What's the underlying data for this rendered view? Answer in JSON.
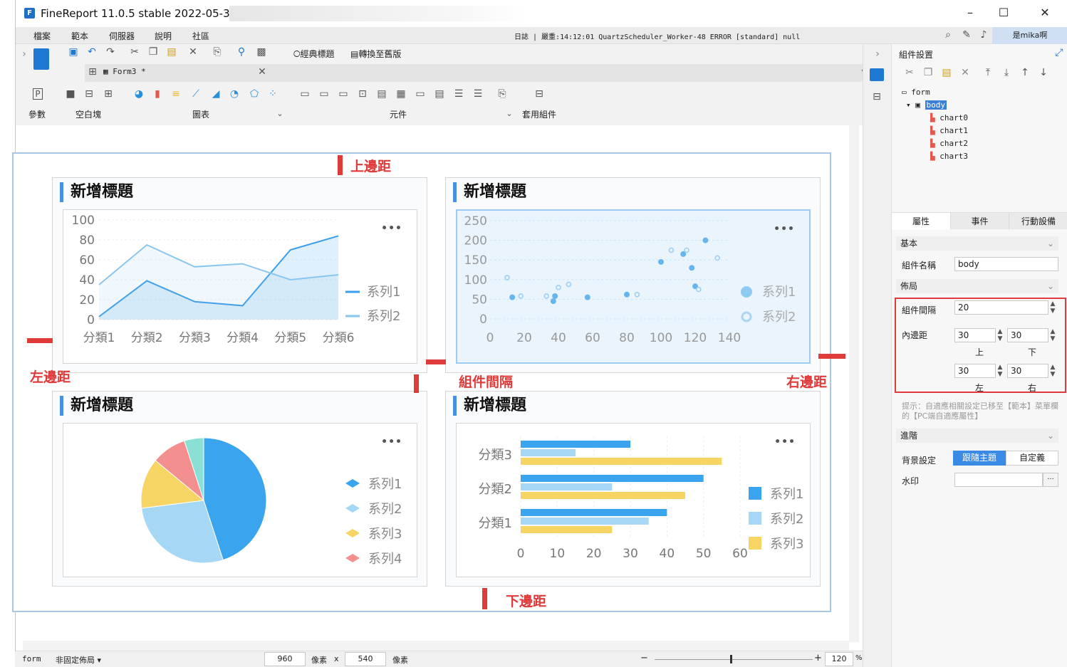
{
  "window": {
    "title": "FineReport 11.0.5 stable 2022-05-30"
  },
  "menu": {
    "items": [
      "檔案",
      "範本",
      "伺服器",
      "說明",
      "社區"
    ],
    "log": "日誌 | 嚴重:14:12:01 QuartzScheduler_Worker-48 ERROR [standard] null",
    "user": "是mika啊"
  },
  "toolbar": {
    "classic_title": "經典標題",
    "switch_old": "轉換至舊版",
    "tab_name": "Form3 *",
    "groups": [
      "參數",
      "空白塊",
      "圖表",
      "元件",
      "套用組件"
    ]
  },
  "annotations": {
    "top": "上邊距",
    "left": "左邊距",
    "gap": "組件間隔",
    "right": "右邊距",
    "bottom": "下邊距"
  },
  "cards": [
    {
      "title": "新增標題"
    },
    {
      "title": "新增標題"
    },
    {
      "title": "新增標題"
    },
    {
      "title": "新增標題"
    }
  ],
  "chart_data": [
    {
      "type": "area",
      "categories": [
        "分類1",
        "分類2",
        "分類3",
        "分類4",
        "分類5",
        "分類6"
      ],
      "series": [
        {
          "name": "系列1",
          "values": [
            3,
            39,
            18,
            14,
            70,
            84
          ]
        },
        {
          "name": "系列2",
          "values": [
            35,
            75,
            53,
            56,
            40,
            45
          ]
        }
      ],
      "ylim": [
        0,
        100
      ],
      "yticks": [
        0,
        20,
        40,
        60,
        80,
        100
      ],
      "legend": "right"
    },
    {
      "type": "scatter",
      "series": [
        {
          "name": "系列1",
          "points": [
            [
              13,
              55
            ],
            [
              38,
              58
            ],
            [
              37,
              45
            ],
            [
              57,
              55
            ],
            [
              80,
              62
            ],
            [
              100,
              145
            ],
            [
              118,
              130
            ],
            [
              113,
              165
            ],
            [
              126,
              200
            ],
            [
              120,
              83
            ]
          ]
        },
        {
          "name": "系列2",
          "points": [
            [
              10,
              105
            ],
            [
              18,
              58
            ],
            [
              33,
              58
            ],
            [
              40,
              80
            ],
            [
              46,
              88
            ],
            [
              86,
              62
            ],
            [
              106,
              175
            ],
            [
              115,
              175
            ],
            [
              133,
              155
            ],
            [
              122,
              75
            ]
          ]
        }
      ],
      "xlim": [
        0,
        140
      ],
      "ylim": [
        0,
        250
      ],
      "xticks": [
        0,
        20,
        40,
        60,
        80,
        100,
        120,
        140
      ],
      "yticks": [
        0,
        50,
        100,
        150,
        200,
        250
      ],
      "legend": "right"
    },
    {
      "type": "pie",
      "series": [
        {
          "name": "系列1",
          "value": 45
        },
        {
          "name": "系列2",
          "value": 28
        },
        {
          "name": "系列3",
          "value": 13
        },
        {
          "name": "系列4",
          "value": 9
        },
        {
          "name": "",
          "value": 5
        }
      ],
      "legend": "right"
    },
    {
      "type": "bar",
      "orientation": "horizontal",
      "categories": [
        "分類3",
        "分類2",
        "分類1"
      ],
      "series": [
        {
          "name": "系列1",
          "values": [
            30,
            50,
            40
          ]
        },
        {
          "name": "系列2",
          "values": [
            15,
            25,
            35
          ]
        },
        {
          "name": "系列3",
          "values": [
            55,
            45,
            25
          ]
        }
      ],
      "xlim": [
        0,
        60
      ],
      "xticks": [
        0,
        10,
        20,
        30,
        40,
        50,
        60
      ],
      "legend": "right"
    }
  ],
  "panel": {
    "title": "組件設置",
    "tree": {
      "root": "form",
      "body": "body",
      "children": [
        "chart0",
        "chart1",
        "chart2",
        "chart3"
      ]
    },
    "tabs": [
      "屬性",
      "事件",
      "行動設備"
    ],
    "basic": "基本",
    "name_label": "組件名稱",
    "name_value": "body",
    "layout": "佈局",
    "gap_label": "組件間隔",
    "gap_value": "20",
    "padding_label": "內邊距",
    "pad_top": "30",
    "pad_bottom": "30",
    "pad_left": "30",
    "pad_right": "30",
    "top": "上",
    "bottom": "下",
    "left": "左",
    "right": "右",
    "hint": "提示：自適應相關設定已移至【範本】菜單欄的【PC端自適應屬性】",
    "advanced": "進階",
    "bg_label": "背景設定",
    "bg_follow": "跟隨主題",
    "bg_custom": "自定義",
    "watermark": "水印"
  },
  "status": {
    "form": "form",
    "layout": "非固定佈局",
    "width": "960",
    "px1": "像素",
    "x": "x",
    "height": "540",
    "px2": "像素",
    "zoom": "120",
    "pct": "%"
  }
}
